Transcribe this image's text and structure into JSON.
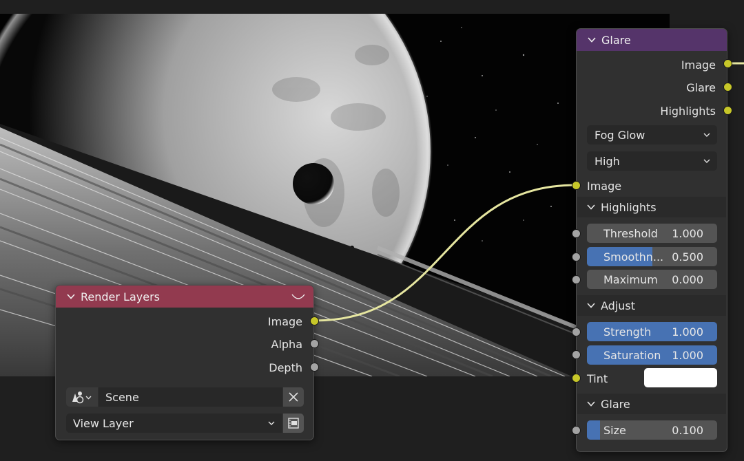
{
  "render_layers": {
    "title": "Render Layers",
    "header_color": "#923a4f",
    "outputs": [
      "Image",
      "Alpha",
      "Depth"
    ],
    "scene_value": "Scene",
    "view_layer_value": "View Layer",
    "icons": [
      "chevron-down-icon",
      "scene-icon",
      "close-icon",
      "film-icon"
    ]
  },
  "glare": {
    "title": "Glare",
    "header_color": "#55346a",
    "outputs": [
      "Image",
      "Glare",
      "Highlights"
    ],
    "glare_type": "Fog Glow",
    "quality": "High",
    "input_image": "Image",
    "highlights_panel": "Highlights",
    "threshold": {
      "label": "Threshold",
      "value": "1.000"
    },
    "smoothness": {
      "label": "Smoothn...",
      "value": "0.500",
      "fraction": 0.5
    },
    "maximum": {
      "label": "Maximum",
      "value": "0.000"
    },
    "adjust_panel": "Adjust",
    "strength": {
      "label": "Strength",
      "value": "1.000"
    },
    "saturation": {
      "label": "Saturation",
      "value": "1.000"
    },
    "tint": {
      "label": "Tint",
      "color": "#ffffff"
    },
    "glare_panel": "Glare",
    "size": {
      "label": "Size",
      "value": "0.100",
      "fraction": 0.1
    }
  },
  "colors": {
    "socket_image": "#c7c729",
    "socket_float": "#a3a3a3",
    "wire": "#e6e6a0",
    "field_active": "#4772b3"
  }
}
